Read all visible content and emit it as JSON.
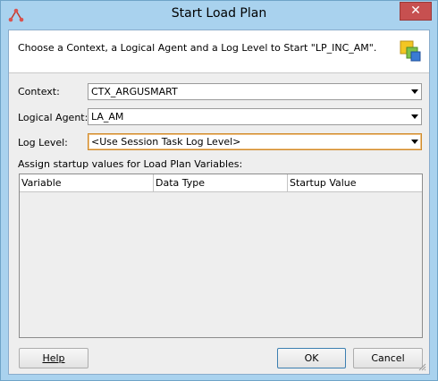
{
  "window": {
    "title": "Start Load Plan",
    "close_glyph": "✕",
    "app_icon": "load-plan-icon"
  },
  "header": {
    "text": "Choose a Context, a Logical Agent and a Log Level to Start \"LP_INC_AM\".",
    "icon": "load-plan-wizard-icon"
  },
  "form": {
    "context_label": "Context:",
    "context_value": "CTX_ARGUSMART",
    "agent_label": "Logical Agent:",
    "agent_value": "LA_AM",
    "loglevel_label": "Log Level:",
    "loglevel_value": "<Use Session Task Log Level>"
  },
  "variables": {
    "caption": "Assign startup values for Load Plan Variables:",
    "columns": [
      "Variable",
      "Data Type",
      "Startup Value"
    ],
    "rows": []
  },
  "buttons": {
    "help": "Help",
    "ok": "OK",
    "cancel": "Cancel"
  },
  "colors": {
    "titlebar": "#a9d2ee",
    "close_button": "#c75050",
    "focus_border": "#d08a2a"
  }
}
